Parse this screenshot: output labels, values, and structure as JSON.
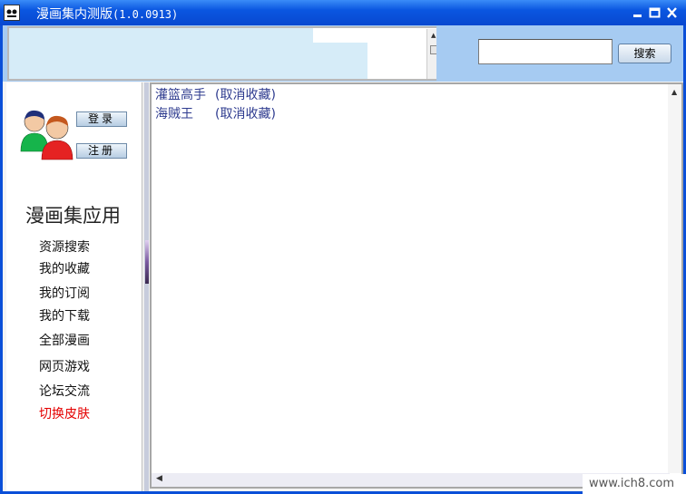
{
  "window": {
    "title": "漫画集内测版",
    "version": "(1.0.0913)",
    "icon": "comic-app-icon"
  },
  "header": {
    "search": {
      "value": "",
      "placeholder": ""
    },
    "search_button": "搜索"
  },
  "sidebar": {
    "login_button": "登录",
    "register_button": "注册",
    "section_title": "漫画集应用",
    "items": [
      {
        "id": "resource-search",
        "label": "资源搜索"
      },
      {
        "id": "my-favorites",
        "label": "我的收藏"
      },
      {
        "id": "my-subscriptions",
        "label": "我的订阅"
      },
      {
        "id": "my-downloads",
        "label": "我的下载"
      },
      {
        "id": "all-comics",
        "label": "全部漫画"
      },
      {
        "id": "web-games",
        "label": "网页游戏"
      },
      {
        "id": "forum",
        "label": "论坛交流"
      },
      {
        "id": "switch-skin",
        "label": "切换皮肤"
      }
    ],
    "accent_color": "#e40000"
  },
  "favorites": [
    {
      "title": "灌篮高手",
      "action": "(取消收藏)"
    },
    {
      "title": "海贼王",
      "action": "(取消收藏)"
    }
  ],
  "watermark": "www.ich8.com",
  "colors": {
    "titlebar": "#0a56e0",
    "banner": "#a6cbf2",
    "link": "#2e3b8f"
  }
}
